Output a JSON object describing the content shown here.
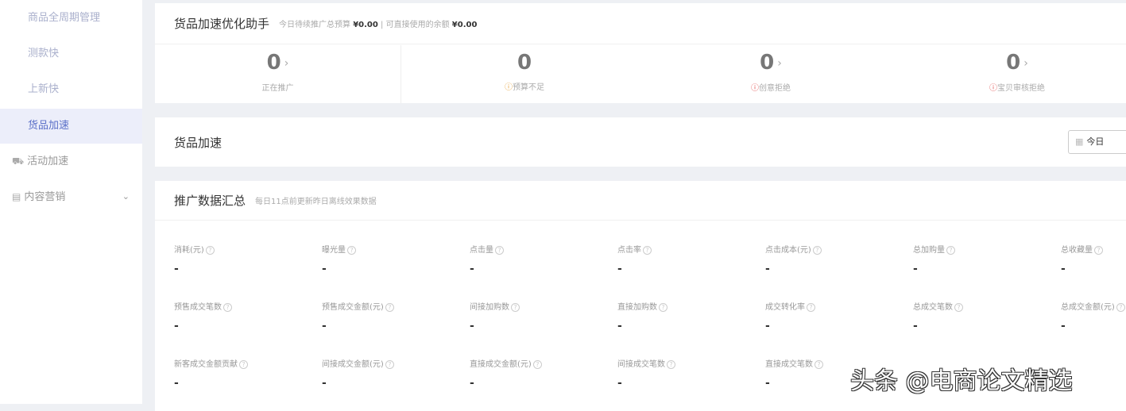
{
  "sidebar": {
    "items": [
      {
        "label": "商品全周期管理"
      },
      {
        "label": "测款快"
      },
      {
        "label": "上新快"
      },
      {
        "label": "货品加速",
        "active": true
      },
      {
        "label": "活动加速",
        "icon": "gift-icon"
      },
      {
        "label": "内容营销",
        "icon": "document-icon",
        "expandable": true
      }
    ]
  },
  "assistant": {
    "title": "货品加速优化助手",
    "budget_label": "今日待续推广总预算",
    "budget_value": "¥0.00",
    "sep": "|",
    "balance_label": "可直接使用的余额",
    "balance_value": "¥0.00",
    "stats": [
      {
        "value": "0",
        "label": "正在推广",
        "arrow": true
      },
      {
        "value": "0",
        "label": "预算不足",
        "status": "warning",
        "arrow": false
      },
      {
        "value": "0",
        "label": "创意拒绝",
        "status": "error",
        "arrow": true
      },
      {
        "value": "0",
        "label": "宝贝审核拒绝",
        "status": "error",
        "arrow": true
      }
    ]
  },
  "accel": {
    "title": "货品加速",
    "date_value": "今日"
  },
  "summary": {
    "title": "推广数据汇总",
    "subtitle": "每日11点前更新昨日离线效果数据",
    "metrics": [
      {
        "label": "消耗(元)",
        "value": "-"
      },
      {
        "label": "曝光量",
        "value": "-"
      },
      {
        "label": "点击量",
        "value": "-"
      },
      {
        "label": "点击率",
        "value": "-"
      },
      {
        "label": "点击成本(元)",
        "value": "-"
      },
      {
        "label": "总加购量",
        "value": "-"
      },
      {
        "label": "总收藏量",
        "value": "-"
      },
      {
        "label": "预售成交笔数",
        "value": "-"
      },
      {
        "label": "预售成交金额(元)",
        "value": "-"
      },
      {
        "label": "间接加购数",
        "value": "-"
      },
      {
        "label": "直接加购数",
        "value": "-"
      },
      {
        "label": "成交转化率",
        "value": "-"
      },
      {
        "label": "总成交笔数",
        "value": "-"
      },
      {
        "label": "总成交金额(元)",
        "value": "-"
      },
      {
        "label": "新客成交金额贡献",
        "value": "-"
      },
      {
        "label": "间接成交金额(元)",
        "value": "-"
      },
      {
        "label": "直接成交金额(元)",
        "value": "-"
      },
      {
        "label": "间接成交笔数",
        "value": "-"
      },
      {
        "label": "直接成交笔数",
        "value": "-"
      }
    ]
  },
  "watermark": "头条 @电商论文精选"
}
